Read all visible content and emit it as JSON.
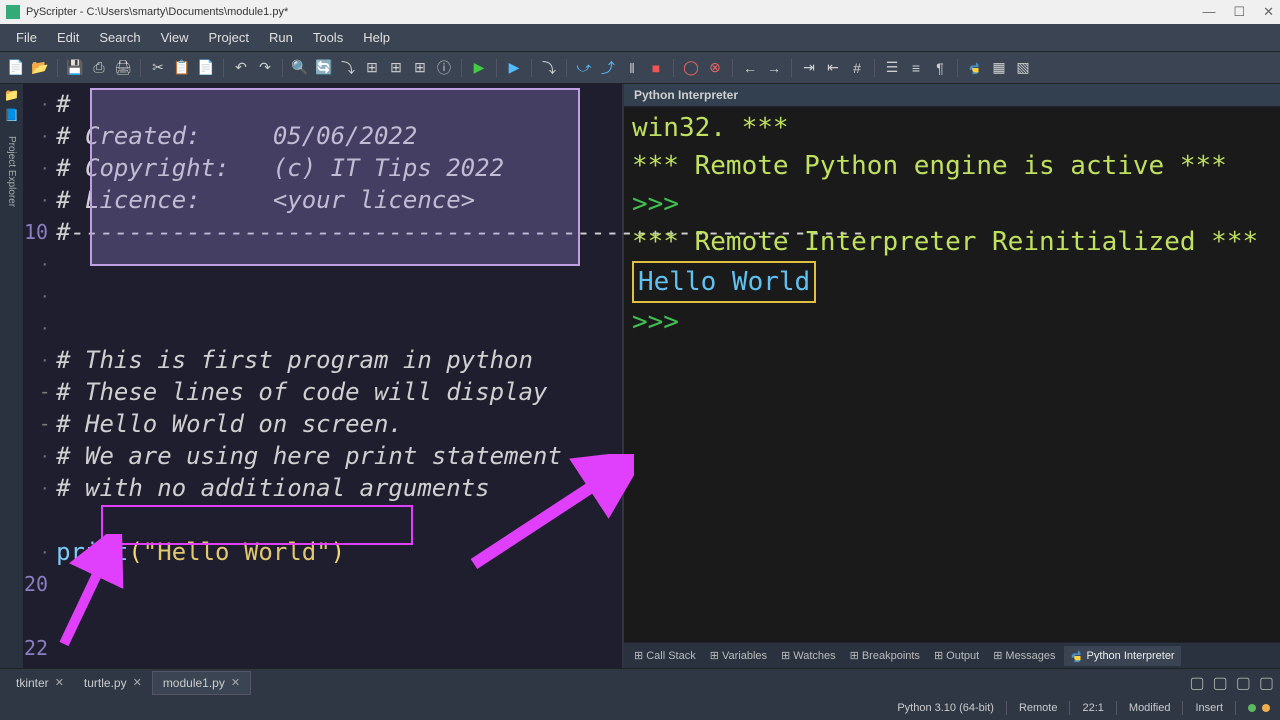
{
  "title": "PyScripter - C:\\Users\\smarty\\Documents\\module1.py*",
  "menu": [
    "File",
    "Edit",
    "Search",
    "View",
    "Project",
    "Run",
    "Tools",
    "Help"
  ],
  "code": {
    "lines": [
      "#",
      "# Created:     05/06/2022",
      "# Copyright:   (c) IT Tips 2022",
      "# Licence:     <your licence>",
      "#------------------------------",
      "",
      "",
      "",
      "# This is first program in python",
      "# These lines of code will display",
      "# Hello World on screen.",
      "# We are using here print statement",
      "# with no additional arguments"
    ],
    "print_func": "print",
    "print_str": "\"Hello World\"",
    "line10": "10",
    "line20": "20",
    "line22": "22"
  },
  "interpreter": {
    "title": "Python Interpreter",
    "l1": "win32. ***",
    "l2": "*** Remote Python engine is active ***",
    "prompt": ">>>",
    "l3": "*** Remote Interpreter Reinitialized ***",
    "output": "Hello World",
    "tabs": [
      "Call Stack",
      "Variables",
      "Watches",
      "Breakpoints",
      "Output",
      "Messages",
      "Python Interpreter"
    ]
  },
  "tabs": [
    {
      "label": "tkinter",
      "active": false
    },
    {
      "label": "turtle.py",
      "active": false
    },
    {
      "label": "module1.py",
      "active": true
    }
  ],
  "status": {
    "python": "Python 3.10 (64-bit)",
    "remote": "Remote",
    "pos": "22:1",
    "modified": "Modified",
    "insert": "Insert"
  }
}
